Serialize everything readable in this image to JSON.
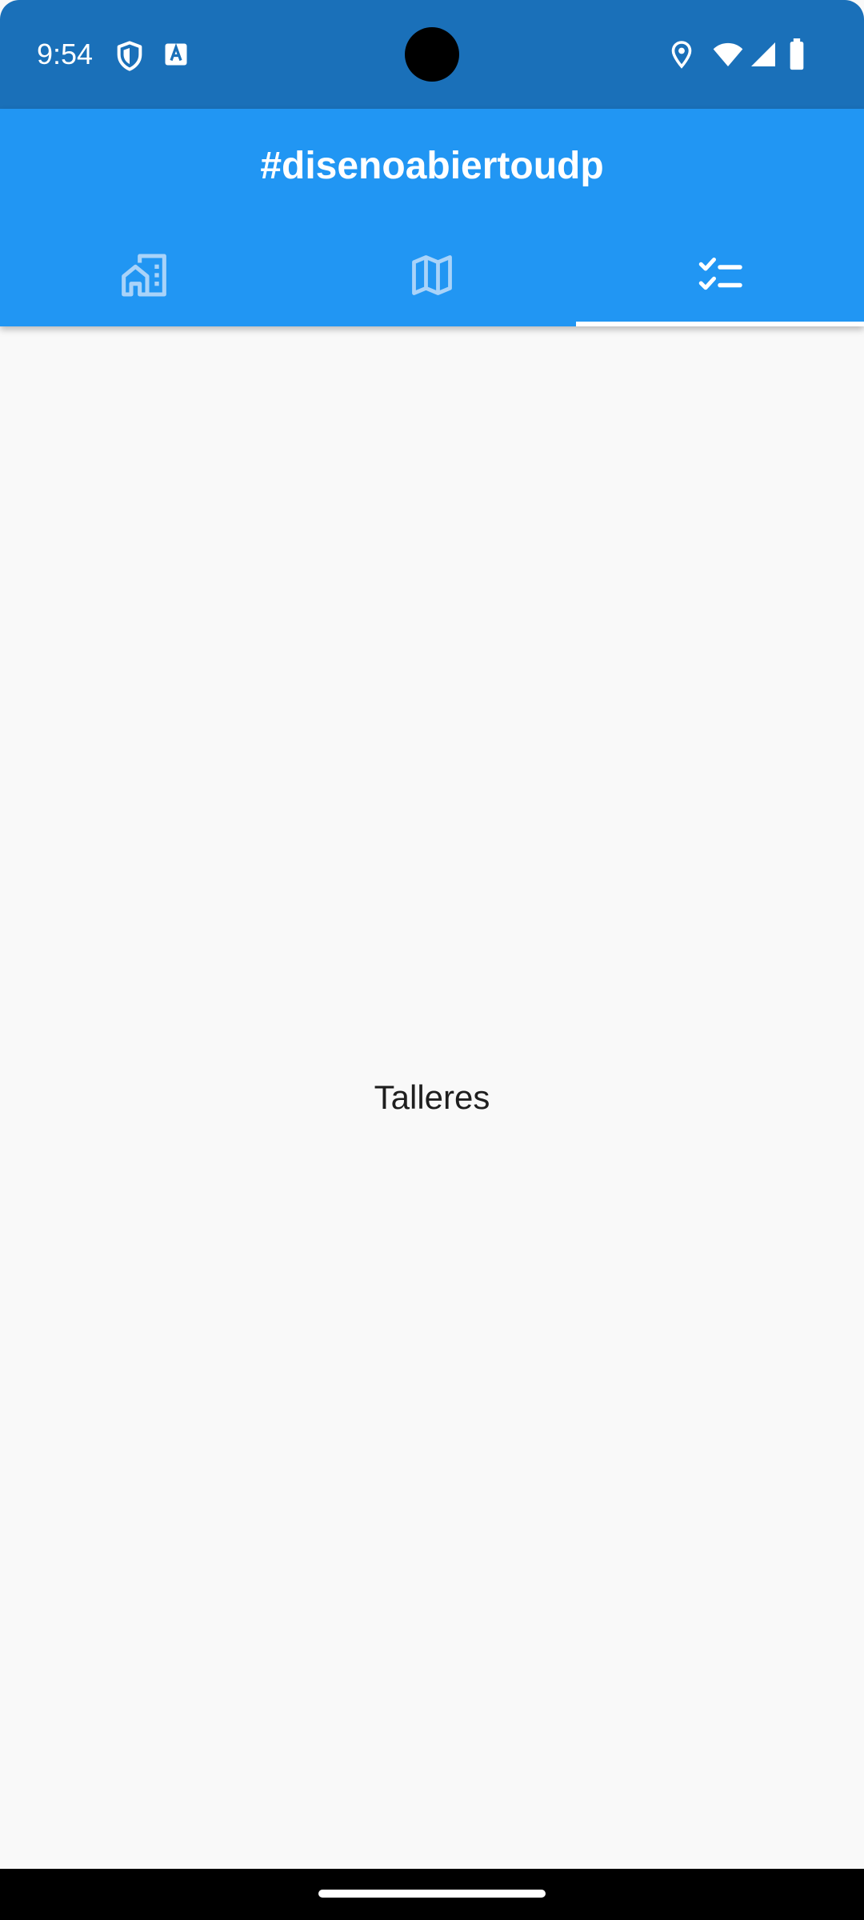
{
  "status_bar": {
    "time": "9:54",
    "icons_left": [
      "shield-icon",
      "keyboard-a-icon"
    ],
    "icons_right": [
      "location-icon",
      "wifi-icon",
      "signal-icon",
      "battery-icon"
    ]
  },
  "app_bar": {
    "title": "#disenoabiertoudp",
    "tabs": [
      {
        "icon": "home-city-icon",
        "selected": false
      },
      {
        "icon": "map-icon",
        "selected": false
      },
      {
        "icon": "checklist-icon",
        "selected": true
      }
    ]
  },
  "main": {
    "body_text": "Talleres"
  },
  "colors": {
    "status_bar": "#1a70b9",
    "app_bar": "#2196f3",
    "background": "#f9f9f9",
    "tab_inactive": "#a9d3f9",
    "tab_active": "#ffffff"
  }
}
